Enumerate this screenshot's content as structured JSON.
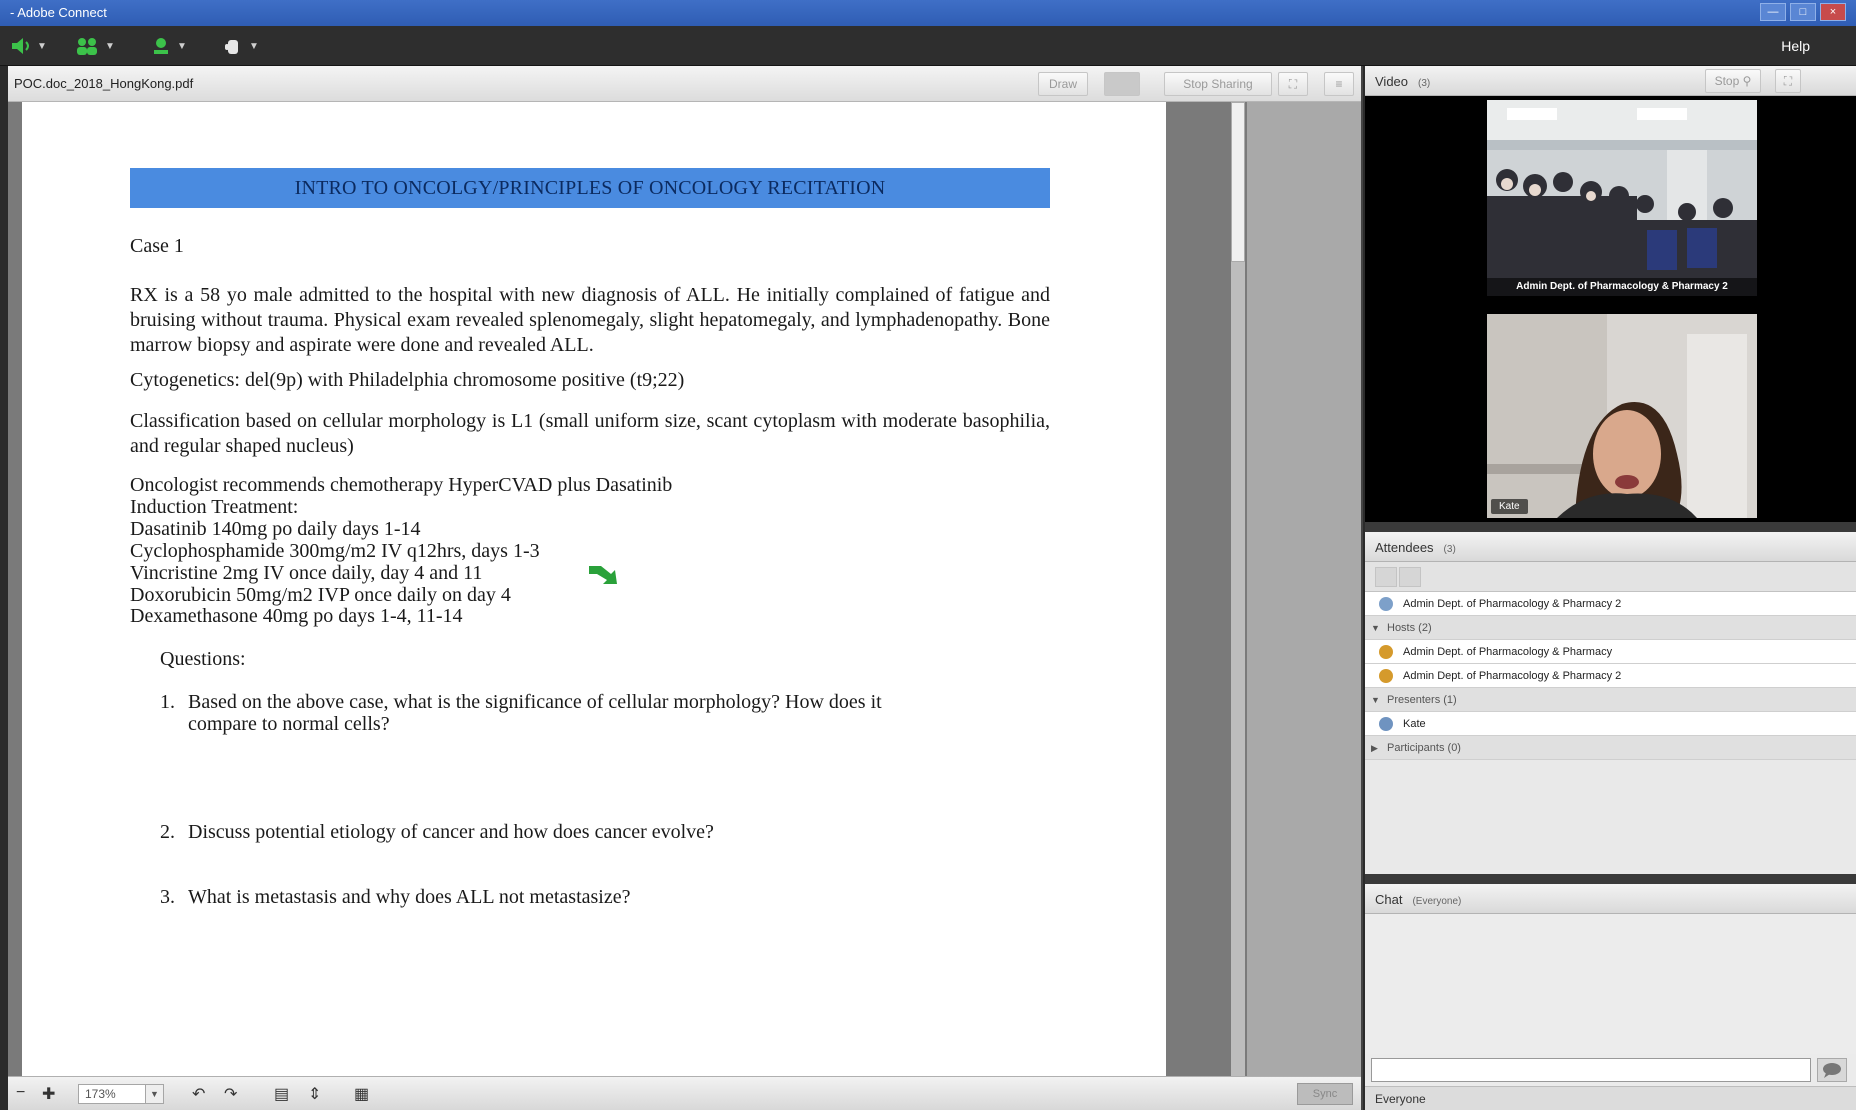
{
  "window": {
    "title": "- Adobe Connect"
  },
  "toolbar": {
    "help_label": "Help"
  },
  "share_pod": {
    "title": "POC.doc_2018_HongKong.pdf",
    "buttons": {
      "draw": "Draw",
      "stop_sharing": "Stop Sharing"
    }
  },
  "document": {
    "banner": "INTRO TO ONCOLGY/PRINCIPLES OF ONCOLOGY RECITATION",
    "case_label": "Case 1",
    "paragraph1": "RX is a 58 yo male admitted to the hospital with new diagnosis of ALL. He initially complained of fatigue and bruising without trauma. Physical exam revealed splenomegaly, slight hepatomegaly, and lymphadenopathy.  Bone marrow biopsy and aspirate were done and revealed ALL.",
    "cytogenetics": "Cytogenetics:  del(9p) with Philadelphia  chromosome positive  (t9;22)",
    "classification": "Classification  based on cellular  morphology  is L1 (small uniform  size, scant cytoplasm with moderate basophilia,  and regular shaped nucleus)",
    "oncologist": "Oncologist  recommends  chemotherapy  HyperCVAD plus  Dasatinib",
    "induction": "Induction  Treatment:",
    "drugs": [
      "Dasatinib 140mg  po daily  days  1-14",
      "Cyclophosphamide   300mg/m2  IV q12hrs,  days 1-3",
      "Vincristine  2mg  IV once daily,  day 4 and 11",
      "Doxorubicin  50mg/m2  IVP once daily  on day 4",
      "Dexamethasone 40mg po days 1-4,  11-14"
    ],
    "questions_label": "Questions:",
    "questions": [
      {
        "num": "1.",
        "line1": "Based on the above case, what is the significance  of cellular  morphology?   How does it",
        "line2": "compare to normal cells?"
      },
      {
        "num": "2.",
        "line1": "Discuss potential  etiology  of cancer and how does cancer evolve?"
      },
      {
        "num": "3.",
        "line1": "What is metastasis and why does ALL not metastasize?"
      }
    ]
  },
  "footer": {
    "zoom": "173%",
    "sync_label": "Sync"
  },
  "video_pod": {
    "title": "Video",
    "count": "(3)",
    "stop_label": "Stop",
    "feeds": [
      {
        "label": "Admin Dept. of Pharmacology & Pharmacy 2"
      },
      {
        "label": "Kate"
      }
    ]
  },
  "attendees_pod": {
    "title": "Attendees",
    "count": "(3)",
    "me": "Admin Dept. of Pharmacology & Pharmacy 2",
    "sections": [
      {
        "label": "Hosts (2)",
        "people": [
          "Admin Dept. of Pharmacology & Pharmacy",
          "Admin Dept. of Pharmacology & Pharmacy 2"
        ]
      },
      {
        "label": "Presenters (1)",
        "people": [
          "Kate"
        ]
      },
      {
        "label": "Participants (0)",
        "people": []
      }
    ]
  },
  "chat_pod": {
    "title": "Chat",
    "scope": "(Everyone)",
    "recipient": "Everyone"
  },
  "colors": {
    "banner": "#4a8be0",
    "title_bar": "#2f5db4",
    "arrow": "#2aa13a"
  }
}
